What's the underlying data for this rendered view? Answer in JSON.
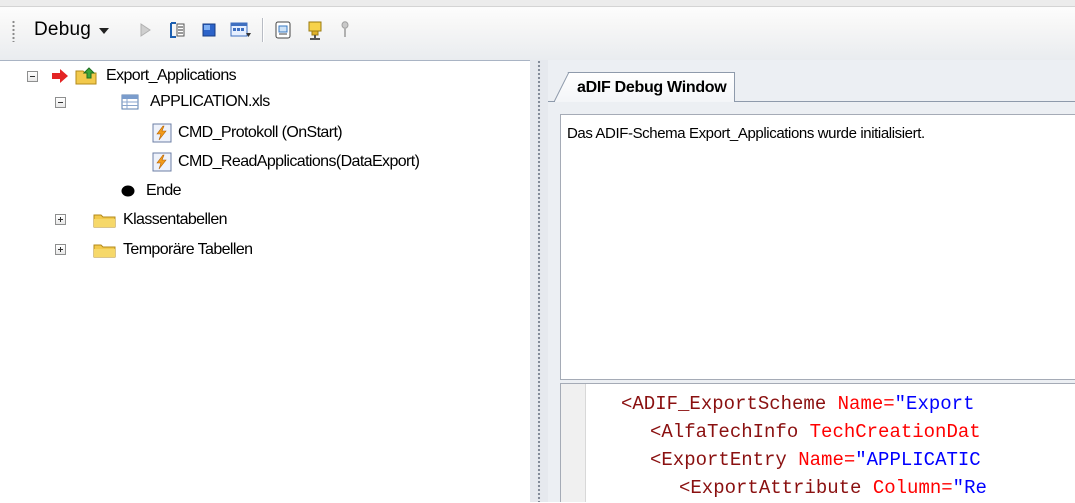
{
  "toolbar": {
    "debug_label": "Debug",
    "buttons": [
      "play-icon",
      "step-list-icon",
      "stop-square-icon",
      "window-list-icon",
      "script-page-icon",
      "import-plug-icon",
      "pin-icon"
    ]
  },
  "tree": {
    "items": [
      {
        "label": "Export_Applications",
        "icon": "folder-up-icon",
        "marker": "red-arrow-icon",
        "expander": "minus"
      },
      {
        "label": "APPLICATION.xls",
        "icon": "table-icon",
        "expander": "minus"
      },
      {
        "label": "CMD_Protokoll (OnStart)",
        "icon": "lightning-cmd-icon"
      },
      {
        "label": "CMD_ReadApplications(DataExport)",
        "icon": "lightning-cmd-icon"
      },
      {
        "label": "Ende",
        "icon": "black-dot-icon"
      },
      {
        "label": "Klassentabellen",
        "icon": "folder-icon",
        "expander": "plus"
      },
      {
        "label": "Temporäre Tabellen",
        "icon": "folder-icon",
        "expander": "plus"
      }
    ]
  },
  "debug_window": {
    "tab_label": "aDIF Debug Window",
    "message": "Das ADIF-Schema Export_Applications wurde initialisiert.",
    "xml": [
      {
        "tag": "<ADIF_ExportScheme",
        "attr": "Name=",
        "val": "\"Export"
      },
      {
        "tag": "<AlfaTechInfo",
        "attr": "TechCreationDat",
        "val": ""
      },
      {
        "tag": "<ExportEntry",
        "attr": "Name=",
        "val": "\"APPLICATIC"
      },
      {
        "tag": "<ExportAttribute",
        "attr": "Column=",
        "val": "\"Re"
      }
    ]
  },
  "colors": {
    "xml_tag": "#8a1010",
    "xml_attr": "#ff0000",
    "xml_value": "#0000ff",
    "pane_border": "#8e9aab"
  }
}
